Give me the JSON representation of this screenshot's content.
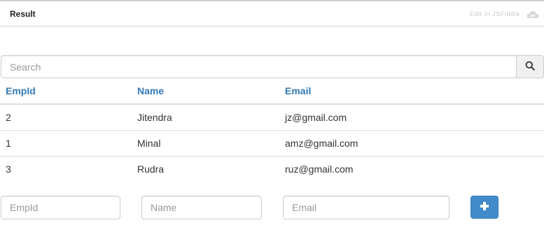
{
  "header": {
    "title": "Result",
    "edit_link": "Edit in JSFiddle",
    "logo_icon": "jsfiddle-cloud-icon"
  },
  "search": {
    "placeholder": "Search",
    "value": "",
    "button_icon": "search-icon"
  },
  "table": {
    "columns": [
      "EmpId",
      "Name",
      "Email"
    ],
    "rows": [
      {
        "empid": "2",
        "name": "Jitendra",
        "email": "jz@gmail.com"
      },
      {
        "empid": "1",
        "name": "Minal",
        "email": "amz@gmail.com"
      },
      {
        "empid": "3",
        "name": "Rudra",
        "email": "ruz@gmail.com"
      }
    ]
  },
  "form": {
    "empid_placeholder": "EmpId",
    "name_placeholder": "Name",
    "email_placeholder": "Email",
    "add_icon": "plus-icon"
  },
  "colors": {
    "link": "#337ab7",
    "primary_button": "#428bca"
  }
}
